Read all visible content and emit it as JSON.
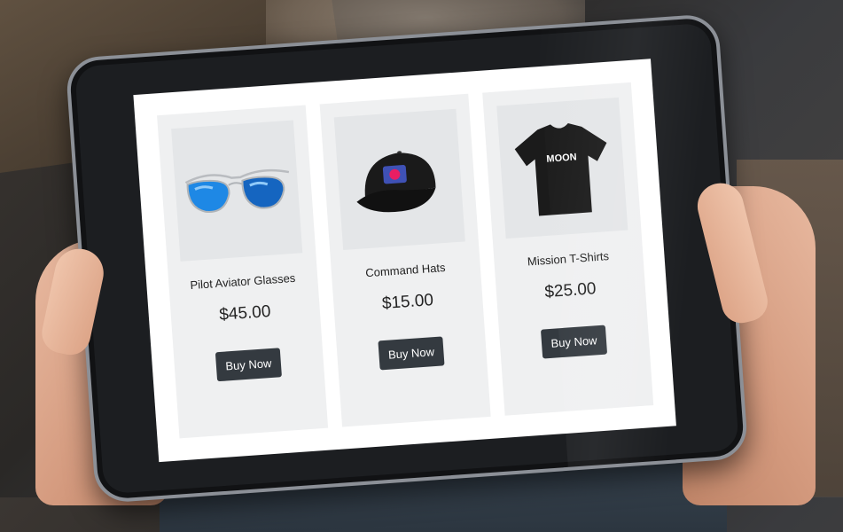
{
  "products": [
    {
      "title": "Pilot Aviator Glasses",
      "price": "$45.00",
      "button": "Buy Now",
      "icon": "aviator-sunglasses-icon"
    },
    {
      "title": "Command Hats",
      "price": "$15.00",
      "button": "Buy Now",
      "icon": "baseball-cap-icon"
    },
    {
      "title": "Mission T-Shirts",
      "price": "$25.00",
      "button": "Buy Now",
      "icon": "t-shirt-icon",
      "shirt_print": "MOON"
    }
  ],
  "colors": {
    "card_bg": "#eff0f1",
    "button_bg": "#343a40",
    "lens_blue": "#1e88e5"
  }
}
